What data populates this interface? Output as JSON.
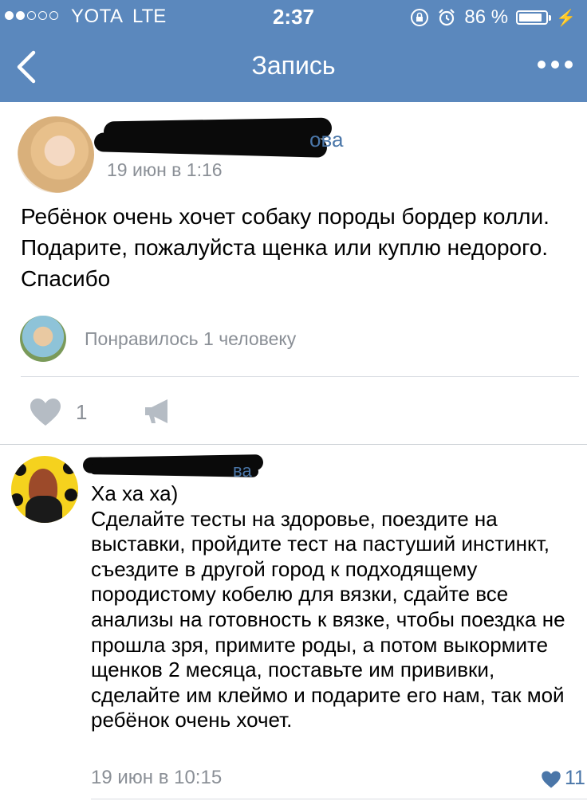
{
  "status_bar": {
    "carrier": "YOTA",
    "network": "LTE",
    "time": "2:37",
    "battery_percent": "86 %",
    "battery_level": 0.86
  },
  "nav": {
    "title": "Запись",
    "back_icon": "chevron-left-icon",
    "more_icon": "ellipsis-icon"
  },
  "post": {
    "author_name_tail": "ова",
    "date": "19 июн в 1:16",
    "text": "Ребёнок очень хочет собаку породы бордер колли. Подарите, пожалуйста щенка или куплю недорого. Спасибо",
    "likes_text": "Понравилось 1 человеку",
    "like_count": "1"
  },
  "comment": {
    "author_name_tail": "ва",
    "text_line1": "Ха ха ха)",
    "text": "Сделайте тесты на здоровье, поездите на выставки, пройдите тест на пастуший инстинкт, съездите в другой город к подходящему породистому кобелю для вязки, сдайте все анализы на готовность к вязке, чтобы поездка не прошла зря, примите роды, а потом выкормите щенков 2 месяца, поставьте им прививки, сделайте им клеймо и подарите его нам, так мой ребёнок очень хочет.",
    "date": "19 июн в 10:15",
    "likes": "11"
  },
  "colors": {
    "nav_bar": "#5b88bd",
    "link": "#4a76a8",
    "muted": "#8a8f96"
  }
}
